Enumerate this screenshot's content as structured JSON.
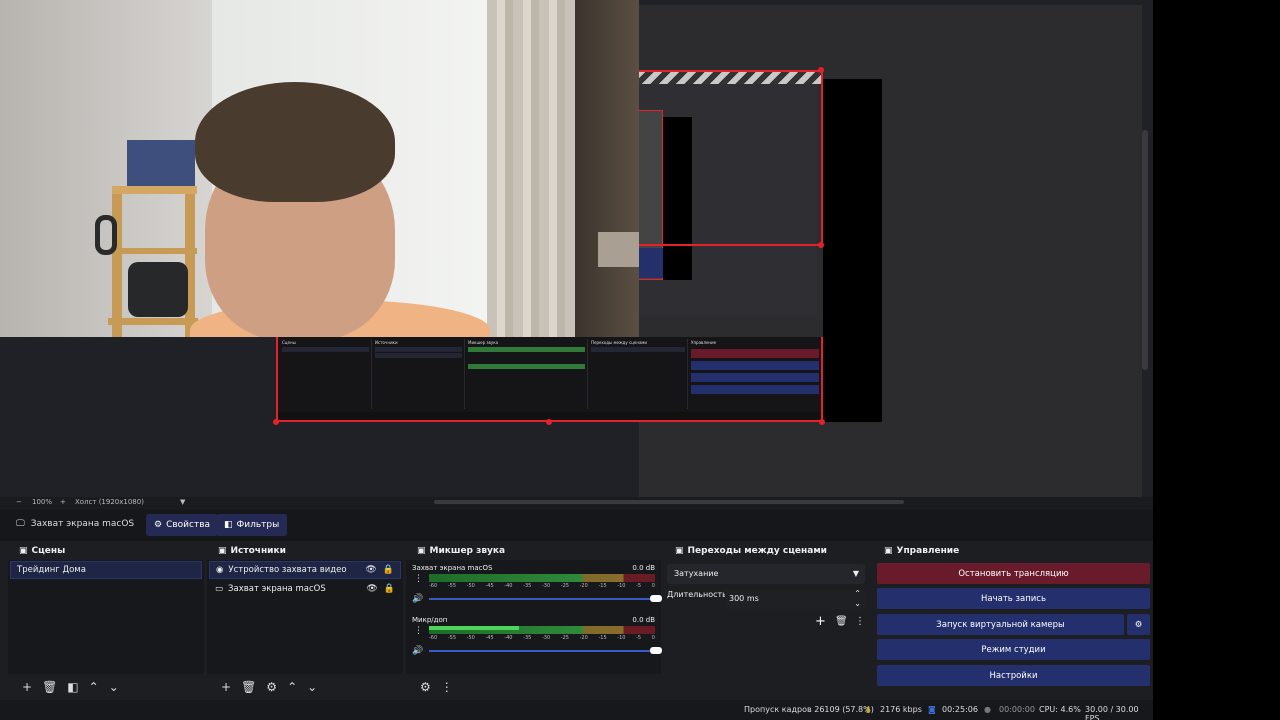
{
  "source_toolbar": {
    "source_name": "Захват экрана macOS",
    "properties_label": "Свойства",
    "filters_label": "Фильтры"
  },
  "zoom_bar": {
    "zoom": "100%",
    "canvas_label": "Холст (1920x1080)"
  },
  "scenes": {
    "title": "Сцены",
    "items": [
      "Трейдинг Дома"
    ]
  },
  "sources": {
    "title": "Источники",
    "items": [
      {
        "label": "Устройство захвата видео",
        "icon": "camera-icon"
      },
      {
        "label": "Захват экрана macOS",
        "icon": "monitor-icon"
      }
    ]
  },
  "mixer": {
    "title": "Микшер звука",
    "channels": [
      {
        "name": "Захват экрана macOS",
        "db": "0.0 dB",
        "level": 0.0
      },
      {
        "name": "Микр/доп",
        "db": "0.0 dB",
        "level": 0.4
      }
    ],
    "scale": [
      "-60",
      "-55",
      "-50",
      "-45",
      "-40",
      "-35",
      "-30",
      "-25",
      "-20",
      "-15",
      "-10",
      "-5",
      "0"
    ]
  },
  "transitions": {
    "title": "Переходы между сценами",
    "selected": "Затухание",
    "duration_label": "Длительность",
    "duration_value": "300 ms"
  },
  "controls": {
    "title": "Управление",
    "stop_stream": "Остановить трансляцию",
    "start_record": "Начать запись",
    "virtual_cam": "Запуск виртуальной камеры",
    "studio_mode": "Режим студии",
    "settings": "Настройки"
  },
  "status": {
    "dropped": "Пропуск кадров 26109 (57.8%)",
    "bitrate": "2176 kbps",
    "stream_time": "00:25:06",
    "rec_time": "00:00:00",
    "cpu": "CPU: 4.6%",
    "fps": "30.00 / 30.00 FPS"
  },
  "colors": {
    "accent": "#24306e",
    "stop": "#6a1b2b",
    "selection_border": "#e5222b"
  }
}
